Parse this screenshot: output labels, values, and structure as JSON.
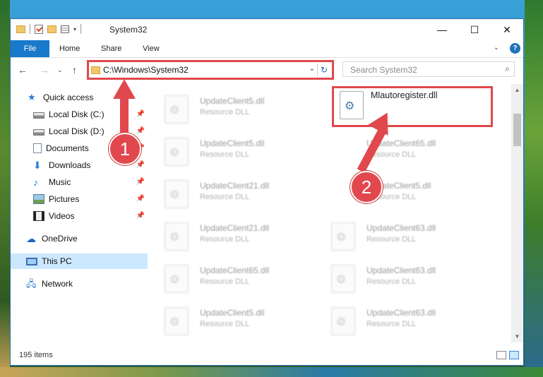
{
  "window": {
    "title": "System32",
    "controls": {
      "minimize": "—",
      "maximize": "☐",
      "close": "✕"
    }
  },
  "ribbon": {
    "tabs": [
      "File",
      "Home",
      "Share",
      "View"
    ],
    "help": "?"
  },
  "address": {
    "path": "C:\\Windows\\System32",
    "search_placeholder": "Search System32"
  },
  "nav": {
    "items": [
      {
        "label": "Quick access",
        "icon": "star-icon"
      },
      {
        "label": "Local Disk (C:)",
        "icon": "disk-icon",
        "pinned": true
      },
      {
        "label": "Local Disk (D:)",
        "icon": "disk-icon",
        "pinned": true
      },
      {
        "label": "Documents",
        "icon": "documents-icon",
        "pinned": true
      },
      {
        "label": "Downloads",
        "icon": "download-icon",
        "pinned": true
      },
      {
        "label": "Music",
        "icon": "music-icon",
        "pinned": true
      },
      {
        "label": "Pictures",
        "icon": "pictures-icon",
        "pinned": true
      },
      {
        "label": "Videos",
        "icon": "videos-icon",
        "pinned": true
      },
      {
        "label": "OneDrive",
        "icon": "cloud-icon"
      },
      {
        "label": "This PC",
        "icon": "computer-icon",
        "selected": true
      },
      {
        "label": "Network",
        "icon": "network-icon"
      }
    ]
  },
  "files": {
    "left": [
      {
        "name": "UpdateClient5.dll",
        "type": "Resource DLL"
      },
      {
        "name": "UpdateClient5.dll",
        "type": "Resource DLL"
      },
      {
        "name": "UpdateClient21.dll",
        "type": "Resource DLL"
      },
      {
        "name": "UpdateClient21.dll",
        "type": "Resource DLL"
      },
      {
        "name": "UpdateClient65.dll",
        "type": "Resource DLL"
      },
      {
        "name": "UpdateClient5.dll",
        "type": "Resource DLL"
      }
    ],
    "right": [
      {
        "name": "Mlautoregister.dll",
        "type": ""
      },
      {
        "name": "UpdateClient65.dll",
        "type": "Resource DLL"
      },
      {
        "name": "UpdateClient5.dll",
        "type": "Resource DLL"
      },
      {
        "name": "UpdateClient63.dll",
        "type": "Resource DLL"
      },
      {
        "name": "UpdateClient63.dll",
        "type": "Resource DLL"
      },
      {
        "name": "UpdateClient63.dll",
        "type": "Resource DLL"
      }
    ]
  },
  "status": {
    "item_count": "195 items"
  },
  "annotations": {
    "step1": "1",
    "step2": "2",
    "color": "#e0484d"
  }
}
